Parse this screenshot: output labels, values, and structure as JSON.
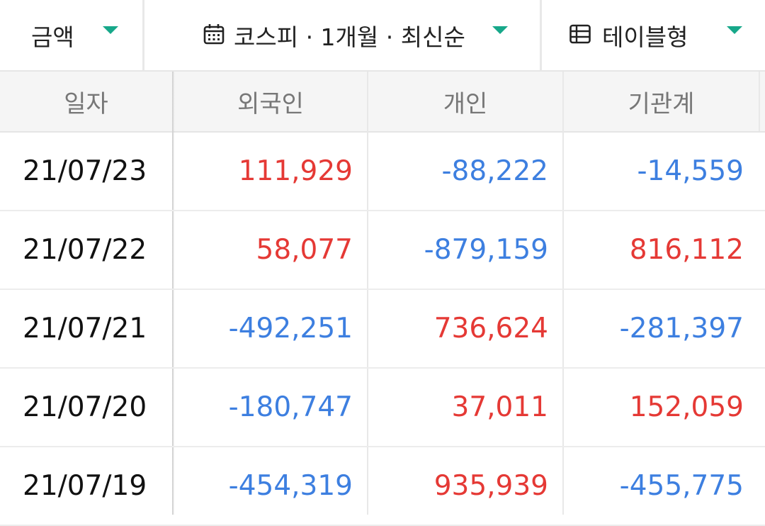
{
  "filters": {
    "unit": {
      "label": "금액"
    },
    "period": {
      "label": "코스피 · 1개월 · 최신순"
    },
    "view": {
      "label": "테이블형"
    }
  },
  "table": {
    "headers": {
      "date": "일자",
      "foreign": "외국인",
      "individual": "개인",
      "institution": "기관계"
    },
    "rows": [
      {
        "date": "21/07/23",
        "foreign": "111,929",
        "individual": "-88,222",
        "institution": "-14,559"
      },
      {
        "date": "21/07/22",
        "foreign": "58,077",
        "individual": "-879,159",
        "institution": "816,112"
      },
      {
        "date": "21/07/21",
        "foreign": "-492,251",
        "individual": "736,624",
        "institution": "-281,397"
      },
      {
        "date": "21/07/20",
        "foreign": "-180,747",
        "individual": "37,011",
        "institution": "152,059"
      },
      {
        "date": "21/07/19",
        "foreign": "-454,319",
        "individual": "935,939",
        "institution": "-455,775"
      }
    ]
  },
  "colors": {
    "positive": "#e53935",
    "negative": "#3d7fe0",
    "accent": "#17a88a"
  },
  "icons": {
    "calendar": "calendar-icon",
    "table": "table-icon",
    "dropdown": "caret-down-icon"
  }
}
